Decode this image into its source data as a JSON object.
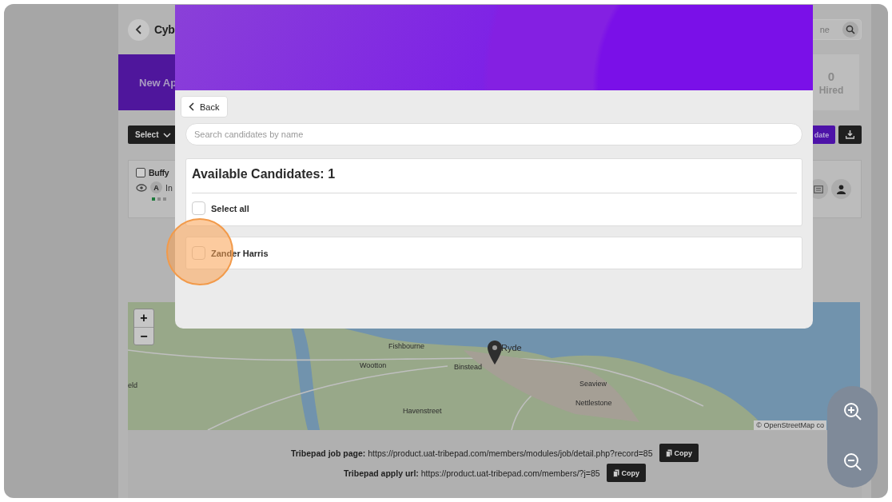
{
  "header": {
    "title": "Cyb",
    "search": {
      "placeholder": "ne"
    }
  },
  "stats": {
    "first_label": "New Ap",
    "hired": {
      "value": "0",
      "label": "Hired"
    }
  },
  "toolbar": {
    "select_label": "Select",
    "update_label": "date"
  },
  "candidate_card": {
    "checked": false,
    "name": "Buffy",
    "avatar": "A",
    "status": "In",
    "stages": [
      {
        "done": true
      },
      {
        "done": false
      },
      {
        "done": false
      }
    ]
  },
  "map": {
    "zoom_in": "+",
    "zoom_out": "−",
    "places": [
      "Fishbourne",
      "Ryde",
      "Wootton",
      "Binstead",
      "eld",
      "Seaview",
      "Nettlestone",
      "Havenstreet"
    ],
    "attribution": "© OpenStreetMap co"
  },
  "links": [
    {
      "label": "Tribepad job page:",
      "url": "https://product.uat-tribepad.com/members/modules/job/detail.php?record=85",
      "button": "Copy"
    },
    {
      "label": "Tribepad apply url:",
      "url": "https://product.uat-tribepad.com/members/?j=85",
      "button": "Copy"
    }
  ],
  "modal": {
    "back": "Back",
    "search_placeholder": "Search candidates by name",
    "heading": "Available Candidates: 1",
    "select_all": {
      "label": "Select all",
      "checked": false
    },
    "candidates": [
      {
        "name": "Zander Harris",
        "checked": false
      }
    ]
  }
}
